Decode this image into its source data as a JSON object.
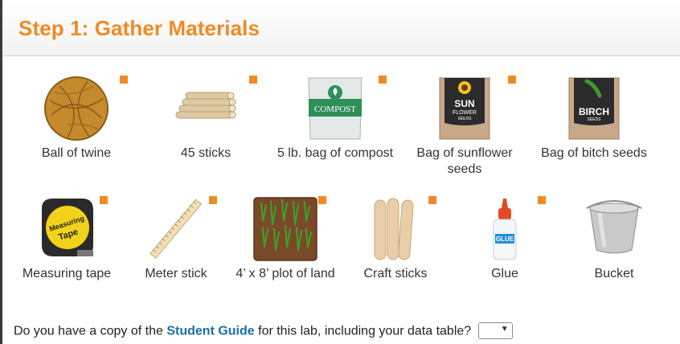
{
  "title": "Step 1: Gather Materials",
  "items": [
    {
      "label": "Ball of twine",
      "icon": "ball-of-twine-icon"
    },
    {
      "label": "45 sticks",
      "icon": "sticks-icon"
    },
    {
      "label": "5 lb. bag of compost",
      "icon": "compost-bag-icon",
      "bag_text": "COMPOST"
    },
    {
      "label": "Bag of sunflower seeds",
      "icon": "sunflower-seeds-icon",
      "bag_text1": "SUN",
      "bag_text2": "FLOWER",
      "bag_text3": "SEEDS"
    },
    {
      "label": "Bag of bitch seeds",
      "icon": "birch-seeds-icon",
      "bag_text1": "BIRCH",
      "bag_text2": "SEEDS"
    },
    {
      "label": "Measuring tape",
      "icon": "measuring-tape-icon",
      "tape_text1": "Measuring",
      "tape_text2": "Tape"
    },
    {
      "label": "Meter stick",
      "icon": "meter-stick-icon"
    },
    {
      "label": "4’ x 8’ plot of land",
      "icon": "plot-of-land-icon"
    },
    {
      "label": "Craft sticks",
      "icon": "craft-sticks-icon"
    },
    {
      "label": "Glue",
      "icon": "glue-icon",
      "glue_text": "GLUE"
    },
    {
      "label": "Bucket",
      "icon": "bucket-icon"
    }
  ],
  "question": {
    "before": "Do you have a copy of the ",
    "link": "Student Guide",
    "after": " for this lab, including your data table?",
    "select_value": ""
  },
  "colors": {
    "accent": "#f08a24",
    "link": "#1a6ea8"
  }
}
